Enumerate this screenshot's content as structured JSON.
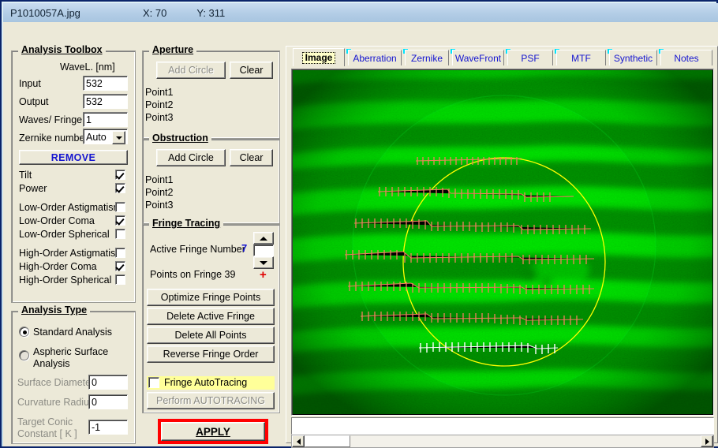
{
  "titlebar": {
    "filename": "P1010057A.jpg",
    "x_label": "X: 70",
    "y_label": "Y: 311"
  },
  "analysis_toolbox": {
    "legend": "Analysis Toolbox",
    "wavelength_header": "WaveL. [nm]",
    "input_label": "Input",
    "input_value": "532",
    "output_label": "Output",
    "output_value": "532",
    "waves_per_fringe_label": "Waves/ Fringe",
    "waves_per_fringe_value": "1",
    "zernike_number_label": "Zernike number",
    "zernike_number_value": "Auto",
    "remove_label": "REMOVE",
    "aberrations": [
      {
        "label": "Tilt",
        "checked": true
      },
      {
        "label": "Power",
        "checked": true
      },
      {
        "label": "Low-Order  Astigmatism",
        "checked": false
      },
      {
        "label": "Low-Order  Coma",
        "checked": true
      },
      {
        "label": "Low-Order  Spherical",
        "checked": false
      },
      {
        "label": "High-Order  Astigmatism",
        "checked": false
      },
      {
        "label": "High-Order  Coma",
        "checked": true
      },
      {
        "label": "High-Order  Spherical",
        "checked": false
      }
    ]
  },
  "analysis_type": {
    "legend": "Analysis Type",
    "standard_label": "Standard  Analysis",
    "standard_selected": true,
    "aspheric_label_line1": "Aspheric  Surface",
    "aspheric_label_line2": "Analysis",
    "aspheric_selected": false,
    "surface_diameter_label": "Surface Diameter",
    "surface_diameter_value": "0",
    "curvature_radius_label": "Curvature Radius",
    "curvature_radius_value": "0",
    "target_conic_label_line1": "Target Conic",
    "target_conic_label_line2": "Constant [ K ]",
    "target_conic_value": "-1"
  },
  "aperture": {
    "legend": "Aperture",
    "add_circle_label": "Add Circle",
    "add_circle_enabled": false,
    "clear_label": "Clear",
    "points": [
      "Point1",
      "Point2",
      "Point3"
    ]
  },
  "obstruction": {
    "legend": "Obstruction",
    "add_circle_label": "Add Circle",
    "add_circle_enabled": true,
    "clear_label": "Clear",
    "points": [
      "Point1",
      "Point2",
      "Point3"
    ]
  },
  "fringe_tracing": {
    "legend": "Fringe Tracing",
    "active_fringe_label": "Active Fringe Number",
    "active_fringe_value": "7",
    "points_on_fringe_label": "Points on  Fringe 39",
    "minus_sign": "-",
    "plus_sign": "+",
    "spinner_value": "",
    "buttons": [
      "Optimize Fringe Points",
      "Delete Active Fringe",
      "Delete  All  Points",
      "Reverse  Fringe Order"
    ],
    "autotracing_label": "Fringe AutoTracing",
    "autotracing_checked": false,
    "perform_autotracing_label": "Perform  AUTOTRACING",
    "perform_autotracing_enabled": false
  },
  "apply": {
    "label": "APPLY"
  },
  "tabs": [
    {
      "label": "Image",
      "active": true
    },
    {
      "label": "Aberration",
      "active": false
    },
    {
      "label": "Zernike",
      "active": false
    },
    {
      "label": "WaveFront",
      "active": false
    },
    {
      "label": "PSF",
      "active": false
    },
    {
      "label": "MTF",
      "active": false
    },
    {
      "label": "Synthetic",
      "active": false
    },
    {
      "label": "Notes",
      "active": false
    }
  ],
  "colors": {
    "accent_blue": "#1515d0",
    "apply_frame_red": "#ff0000",
    "highlight_yellow": "#ffff99",
    "aperture_circle": "#ffff00",
    "traced_fringe": "#f08060",
    "active_fringe": "#ffffff",
    "fringe_bright": "#00e000",
    "fringe_dark": "#003000"
  },
  "interferogram": {
    "description": "green interferogram with horizontal fringes, yellow aperture circle, traced fringe point markers",
    "traced_fringe_count": 7,
    "active_fringe_index": 7
  }
}
